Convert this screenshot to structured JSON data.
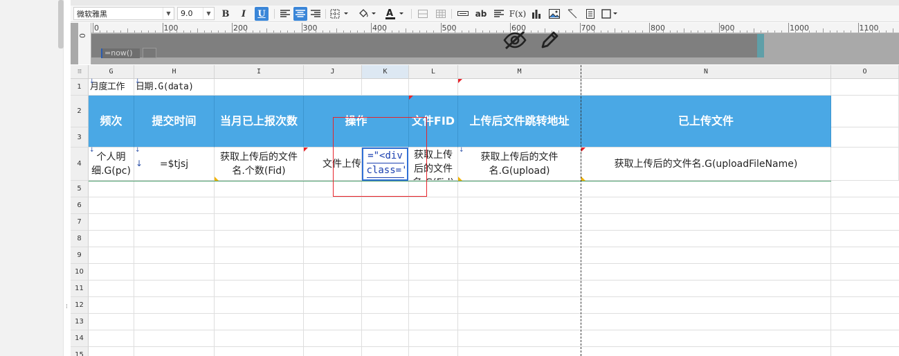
{
  "toolbar": {
    "font_name": "微软雅黑",
    "font_size": "9.0",
    "bold_label": "B",
    "italic_label": "I",
    "underline_label": "U",
    "text_style_label": "ab",
    "formula_label": "F(x)",
    "icons": [
      "align-left-icon",
      "align-center-icon",
      "align-right-icon",
      "border-icon",
      "fill-color-icon",
      "font-color-icon",
      "merge-icon",
      "unmerge-icon",
      "text-icon",
      "paragraph-icon",
      "chart-icon",
      "image-icon",
      "slash-icon",
      "frame-icon",
      "border-style-icon"
    ],
    "accent_color": "#3a86d8"
  },
  "ruler": {
    "ticks": [
      "0",
      "100",
      "200",
      "300",
      "400",
      "500",
      "600",
      "700",
      "800",
      "900",
      "1000",
      "1100"
    ],
    "vertical_label": "0",
    "widget_label": "=now()"
  },
  "sheet": {
    "corner": "⁝⁝⁝",
    "columns": [
      "G",
      "H",
      "I",
      "J",
      "K",
      "L",
      "M",
      "N",
      "O"
    ],
    "rows": [
      "1",
      "2",
      "3",
      "4",
      "5",
      "6",
      "7",
      "8",
      "9",
      "10",
      "11",
      "12",
      "13",
      "14",
      "15"
    ],
    "row1": {
      "g": "月度工作",
      "h": "日期.G(data)"
    },
    "headers": {
      "g": "频次",
      "h": "提交时间",
      "i": "当月已上报次数",
      "jk": "操作",
      "l": "文件FID",
      "m": "上传后文件跳转地址",
      "n": "已上传文件"
    },
    "data": {
      "g": "个人明细.G(pc)",
      "h": "=$tjsj",
      "i": "获取上传后的文件名.个数(Fid)",
      "j": "文件上传",
      "k_lines": [
        "=\"<div",
        "class='"
      ],
      "l": "获取上传后的文件名.G(Fid)",
      "m": "获取上传后的文件名.G(upload)",
      "n": "获取上传后的文件名.G(uploadFileName)"
    },
    "header_color": "#4aa8e5"
  }
}
